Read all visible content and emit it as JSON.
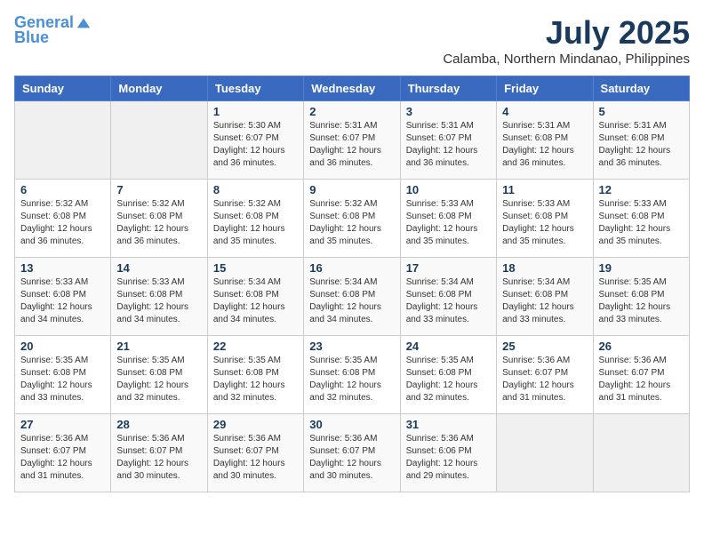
{
  "logo": {
    "line1": "General",
    "line2": "Blue"
  },
  "title": "July 2025",
  "location": "Calamba, Northern Mindanao, Philippines",
  "weekdays": [
    "Sunday",
    "Monday",
    "Tuesday",
    "Wednesday",
    "Thursday",
    "Friday",
    "Saturday"
  ],
  "weeks": [
    [
      {
        "day": "",
        "detail": ""
      },
      {
        "day": "",
        "detail": ""
      },
      {
        "day": "1",
        "detail": "Sunrise: 5:30 AM\nSunset: 6:07 PM\nDaylight: 12 hours\nand 36 minutes."
      },
      {
        "day": "2",
        "detail": "Sunrise: 5:31 AM\nSunset: 6:07 PM\nDaylight: 12 hours\nand 36 minutes."
      },
      {
        "day": "3",
        "detail": "Sunrise: 5:31 AM\nSunset: 6:07 PM\nDaylight: 12 hours\nand 36 minutes."
      },
      {
        "day": "4",
        "detail": "Sunrise: 5:31 AM\nSunset: 6:08 PM\nDaylight: 12 hours\nand 36 minutes."
      },
      {
        "day": "5",
        "detail": "Sunrise: 5:31 AM\nSunset: 6:08 PM\nDaylight: 12 hours\nand 36 minutes."
      }
    ],
    [
      {
        "day": "6",
        "detail": "Sunrise: 5:32 AM\nSunset: 6:08 PM\nDaylight: 12 hours\nand 36 minutes."
      },
      {
        "day": "7",
        "detail": "Sunrise: 5:32 AM\nSunset: 6:08 PM\nDaylight: 12 hours\nand 36 minutes."
      },
      {
        "day": "8",
        "detail": "Sunrise: 5:32 AM\nSunset: 6:08 PM\nDaylight: 12 hours\nand 35 minutes."
      },
      {
        "day": "9",
        "detail": "Sunrise: 5:32 AM\nSunset: 6:08 PM\nDaylight: 12 hours\nand 35 minutes."
      },
      {
        "day": "10",
        "detail": "Sunrise: 5:33 AM\nSunset: 6:08 PM\nDaylight: 12 hours\nand 35 minutes."
      },
      {
        "day": "11",
        "detail": "Sunrise: 5:33 AM\nSunset: 6:08 PM\nDaylight: 12 hours\nand 35 minutes."
      },
      {
        "day": "12",
        "detail": "Sunrise: 5:33 AM\nSunset: 6:08 PM\nDaylight: 12 hours\nand 35 minutes."
      }
    ],
    [
      {
        "day": "13",
        "detail": "Sunrise: 5:33 AM\nSunset: 6:08 PM\nDaylight: 12 hours\nand 34 minutes."
      },
      {
        "day": "14",
        "detail": "Sunrise: 5:33 AM\nSunset: 6:08 PM\nDaylight: 12 hours\nand 34 minutes."
      },
      {
        "day": "15",
        "detail": "Sunrise: 5:34 AM\nSunset: 6:08 PM\nDaylight: 12 hours\nand 34 minutes."
      },
      {
        "day": "16",
        "detail": "Sunrise: 5:34 AM\nSunset: 6:08 PM\nDaylight: 12 hours\nand 34 minutes."
      },
      {
        "day": "17",
        "detail": "Sunrise: 5:34 AM\nSunset: 6:08 PM\nDaylight: 12 hours\nand 33 minutes."
      },
      {
        "day": "18",
        "detail": "Sunrise: 5:34 AM\nSunset: 6:08 PM\nDaylight: 12 hours\nand 33 minutes."
      },
      {
        "day": "19",
        "detail": "Sunrise: 5:35 AM\nSunset: 6:08 PM\nDaylight: 12 hours\nand 33 minutes."
      }
    ],
    [
      {
        "day": "20",
        "detail": "Sunrise: 5:35 AM\nSunset: 6:08 PM\nDaylight: 12 hours\nand 33 minutes."
      },
      {
        "day": "21",
        "detail": "Sunrise: 5:35 AM\nSunset: 6:08 PM\nDaylight: 12 hours\nand 32 minutes."
      },
      {
        "day": "22",
        "detail": "Sunrise: 5:35 AM\nSunset: 6:08 PM\nDaylight: 12 hours\nand 32 minutes."
      },
      {
        "day": "23",
        "detail": "Sunrise: 5:35 AM\nSunset: 6:08 PM\nDaylight: 12 hours\nand 32 minutes."
      },
      {
        "day": "24",
        "detail": "Sunrise: 5:35 AM\nSunset: 6:08 PM\nDaylight: 12 hours\nand 32 minutes."
      },
      {
        "day": "25",
        "detail": "Sunrise: 5:36 AM\nSunset: 6:07 PM\nDaylight: 12 hours\nand 31 minutes."
      },
      {
        "day": "26",
        "detail": "Sunrise: 5:36 AM\nSunset: 6:07 PM\nDaylight: 12 hours\nand 31 minutes."
      }
    ],
    [
      {
        "day": "27",
        "detail": "Sunrise: 5:36 AM\nSunset: 6:07 PM\nDaylight: 12 hours\nand 31 minutes."
      },
      {
        "day": "28",
        "detail": "Sunrise: 5:36 AM\nSunset: 6:07 PM\nDaylight: 12 hours\nand 30 minutes."
      },
      {
        "day": "29",
        "detail": "Sunrise: 5:36 AM\nSunset: 6:07 PM\nDaylight: 12 hours\nand 30 minutes."
      },
      {
        "day": "30",
        "detail": "Sunrise: 5:36 AM\nSunset: 6:07 PM\nDaylight: 12 hours\nand 30 minutes."
      },
      {
        "day": "31",
        "detail": "Sunrise: 5:36 AM\nSunset: 6:06 PM\nDaylight: 12 hours\nand 29 minutes."
      },
      {
        "day": "",
        "detail": ""
      },
      {
        "day": "",
        "detail": ""
      }
    ]
  ]
}
